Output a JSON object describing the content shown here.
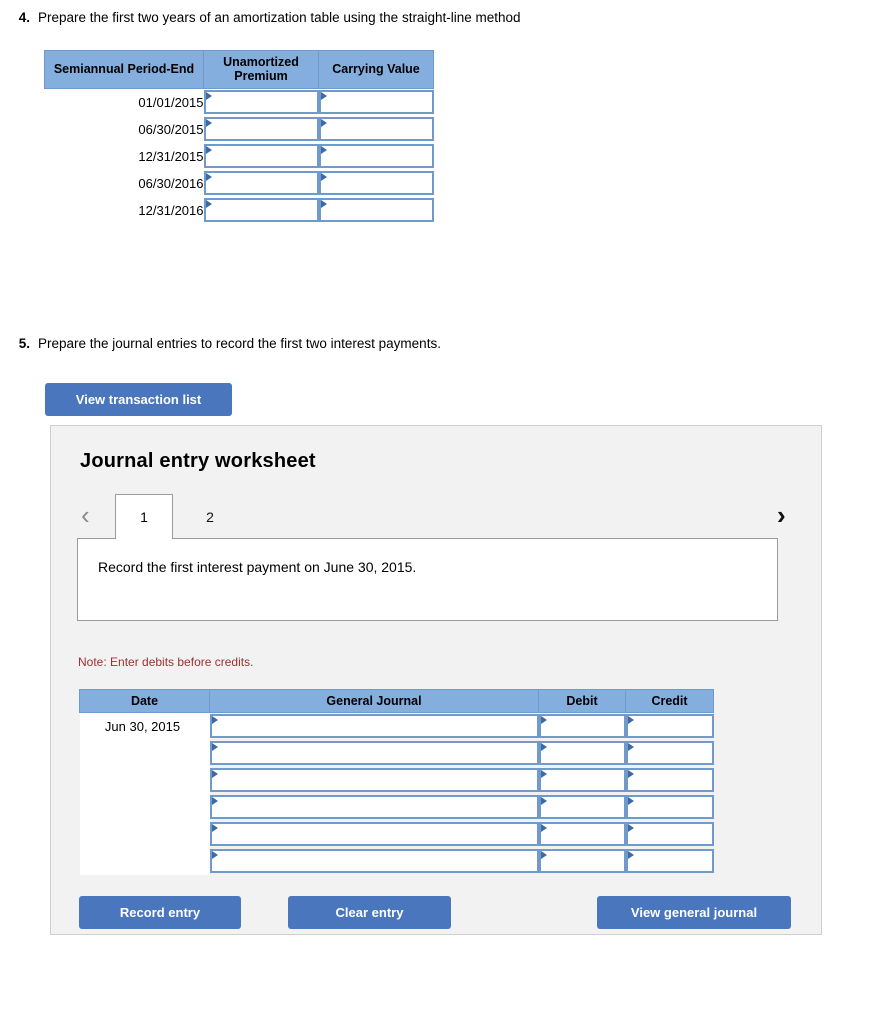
{
  "questions": [
    {
      "number": "4.",
      "text": "Prepare the first two years of an amortization table using the straight-line method"
    },
    {
      "number": "5.",
      "text": "Prepare the journal entries to record the first two interest payments."
    }
  ],
  "amortization_table": {
    "columns": [
      "Semiannual Period-End",
      "Unamortized Premium",
      "Carrying Value"
    ],
    "rows": [
      {
        "period_end": "01/01/2015",
        "unamortized_premium": "",
        "carrying_value": ""
      },
      {
        "period_end": "06/30/2015",
        "unamortized_premium": "",
        "carrying_value": ""
      },
      {
        "period_end": "12/31/2015",
        "unamortized_premium": "",
        "carrying_value": ""
      },
      {
        "period_end": "06/30/2016",
        "unamortized_premium": "",
        "carrying_value": ""
      },
      {
        "period_end": "12/31/2016",
        "unamortized_premium": "",
        "carrying_value": ""
      }
    ]
  },
  "view_transaction_list_label": "View transaction list",
  "worksheet": {
    "title": "Journal entry worksheet",
    "prev_arrow": "‹",
    "next_arrow": "›",
    "tabs": [
      {
        "label": "1",
        "active": true
      },
      {
        "label": "2",
        "active": false
      }
    ],
    "description": "Record the first interest payment on June 30, 2015.",
    "note": "Note: Enter debits before credits.",
    "journal_table": {
      "columns": [
        "Date",
        "General Journal",
        "Debit",
        "Credit"
      ],
      "rows": [
        {
          "date": "Jun 30, 2015",
          "general_journal": "",
          "debit": "",
          "credit": ""
        },
        {
          "date": "",
          "general_journal": "",
          "debit": "",
          "credit": ""
        },
        {
          "date": "",
          "general_journal": "",
          "debit": "",
          "credit": ""
        },
        {
          "date": "",
          "general_journal": "",
          "debit": "",
          "credit": ""
        },
        {
          "date": "",
          "general_journal": "",
          "debit": "",
          "credit": ""
        },
        {
          "date": "",
          "general_journal": "",
          "debit": "",
          "credit": ""
        }
      ]
    },
    "buttons": {
      "record_entry": "Record entry",
      "clear_entry": "Clear entry",
      "view_general_journal": "View general journal"
    }
  },
  "colors": {
    "table_header_blue": "#84aedd",
    "button_blue": "#4a76bd",
    "note_red": "#a03030",
    "panel_bg": "#f2f2f2",
    "input_border_blue": "#6f9acb"
  }
}
